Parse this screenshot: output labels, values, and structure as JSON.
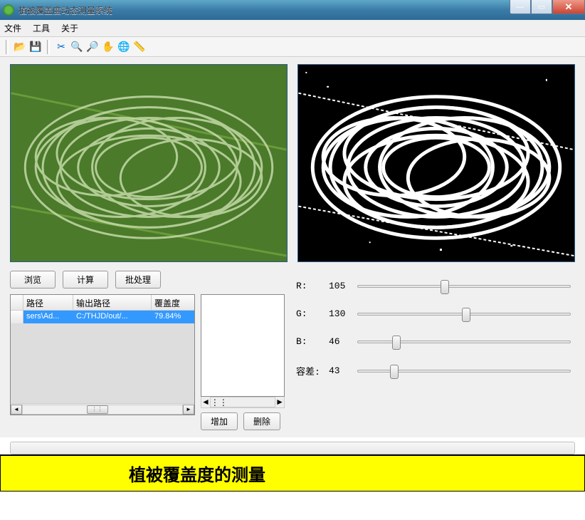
{
  "window": {
    "title": "植被覆盖度动态测量系统"
  },
  "menu": {
    "file": "文件",
    "tools": "工具",
    "about": "关于"
  },
  "toolbar_icons": {
    "open": "open-folder-icon",
    "save": "save-icon",
    "cut": "scissors-icon",
    "zoom_in": "zoom-in-icon",
    "zoom_out": "zoom-out-icon",
    "pan": "hand-icon",
    "globe": "globe-icon",
    "ruler": "ruler-icon"
  },
  "buttons": {
    "browse": "浏览",
    "compute": "计算",
    "batch": "批处理",
    "add": "增加",
    "delete": "删除"
  },
  "table": {
    "headers": {
      "path": "路径",
      "out_path": "输出路径",
      "coverage": "覆盖度"
    },
    "rows": [
      {
        "path": "sers\\Ad...",
        "out_path": "C:/THJD/out/...",
        "coverage": "79.84%"
      }
    ]
  },
  "sliders": {
    "r": {
      "label": "R:",
      "value": 105,
      "max": 255
    },
    "g": {
      "label": "G:",
      "value": 130,
      "max": 255
    },
    "b": {
      "label": "B:",
      "value": 46,
      "max": 255
    },
    "tol": {
      "label": "容差:",
      "value": 43,
      "max": 255
    }
  },
  "footer": {
    "caption": "植被覆盖度的测量"
  }
}
